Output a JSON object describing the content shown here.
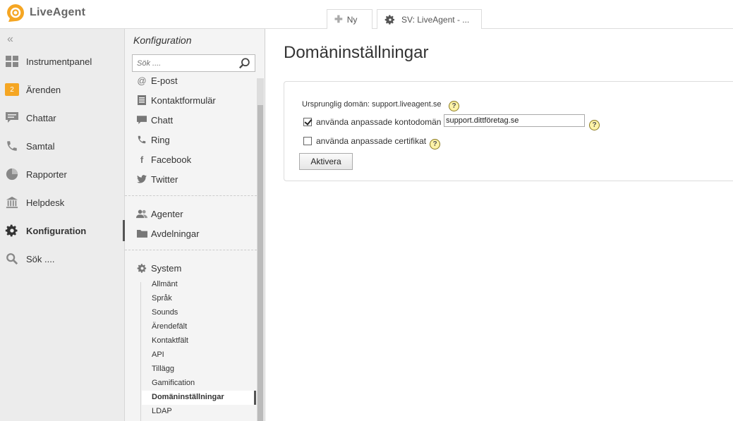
{
  "app": {
    "name": "LiveAgent"
  },
  "tabs": [
    {
      "label": "Ny",
      "icon": "plus-icon"
    },
    {
      "label": "SV: LiveAgent - ...",
      "icon": "gear-icon"
    }
  ],
  "leftnav": {
    "items": [
      {
        "label": "Instrumentpanel",
        "icon": "dashboard-icon"
      },
      {
        "label": "Ärenden",
        "icon": "tickets-badge",
        "badge": "2"
      },
      {
        "label": "Chattar",
        "icon": "chat-icon"
      },
      {
        "label": "Samtal",
        "icon": "phone-icon"
      },
      {
        "label": "Rapporter",
        "icon": "pie-chart-icon"
      },
      {
        "label": "Helpdesk",
        "icon": "helpdesk-icon"
      },
      {
        "label": "Konfiguration",
        "icon": "gear-icon",
        "active": true
      },
      {
        "label": "Sök ....",
        "icon": "search-icon"
      }
    ]
  },
  "config": {
    "title": "Konfiguration",
    "search_placeholder": "Sök ....",
    "channels": [
      "E-post",
      "Kontaktformulär",
      "Chatt",
      "Ring",
      "Facebook",
      "Twitter"
    ],
    "people": [
      "Agenter",
      "Avdelningar"
    ],
    "system_label": "System",
    "system_items": [
      "Allmänt",
      "Språk",
      "Sounds",
      "Ärendefält",
      "Kontaktfält",
      "API",
      "Tillägg",
      "Gamification",
      "Domäninställningar",
      "LDAP"
    ],
    "active_system_item": "Domäninställningar"
  },
  "main": {
    "title": "Domäninställningar",
    "original_domain_text": "Ursprunglig domän: support.liveagent.se",
    "custom_domain_label": "använda anpassade kontodomän",
    "custom_domain_checked": true,
    "custom_domain_value": "support.dittföretag.se",
    "custom_cert_label": "använda anpassade certifikat",
    "custom_cert_checked": false,
    "activate_button": "Aktivera",
    "help_glyph": "?"
  },
  "colors": {
    "brand": "#f5a623",
    "badge": "#f5a623",
    "help_bg": "#fff3a8"
  }
}
